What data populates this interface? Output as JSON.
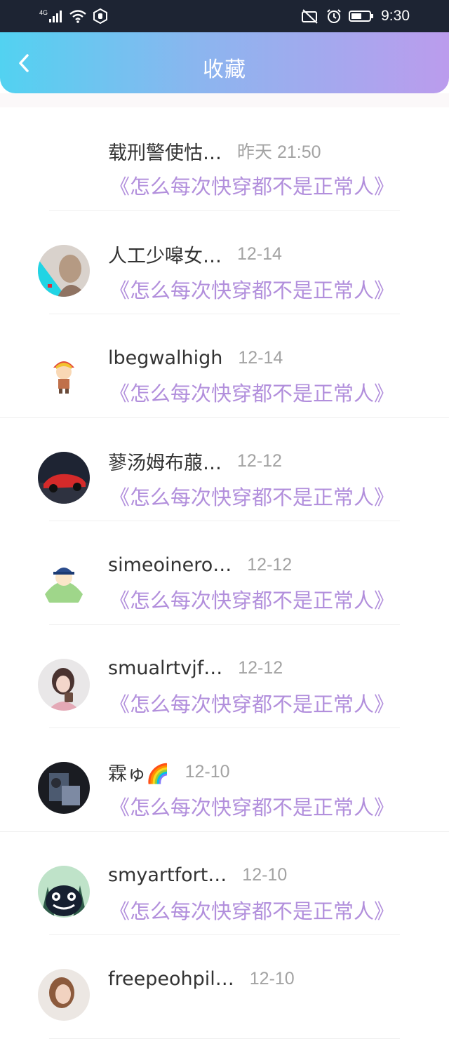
{
  "status_bar": {
    "network": "4G",
    "time": "9:30"
  },
  "header": {
    "title": "收藏"
  },
  "items": [
    {
      "name": "载刑警使怙…",
      "date": "昨天 21:50",
      "book": "《怎么每次快穿都不是正常人》",
      "avatar": "none"
    },
    {
      "name": "人工少嗥女…",
      "date": "12-14",
      "book": "《怎么每次快穿都不是正常人》",
      "avatar": "girl-photo-avatar"
    },
    {
      "name": "lbegwalhigh",
      "date": "12-14",
      "book": "《怎么每次快穿都不是正常人》",
      "avatar": "cartoon-boy-avatar"
    },
    {
      "name": "蓼汤姆布菔…",
      "date": "12-12",
      "book": "《怎么每次快穿都不是正常人》",
      "avatar": "red-car-avatar"
    },
    {
      "name": "simeoinero…",
      "date": "12-12",
      "book": "《怎么每次快穿都不是正常人》",
      "avatar": "cartoon-character-avatar"
    },
    {
      "name": "smualrtvjf…",
      "date": "12-12",
      "book": "《怎么每次快穿都不是正常人》",
      "avatar": "girl-cup-avatar"
    },
    {
      "name": "霖ゅ🌈",
      "date": "12-10",
      "book": "《怎么每次快穿都不是正常人》",
      "avatar": "dark-photo-avatar"
    },
    {
      "name": "smyartfort…",
      "date": "12-10",
      "book": "《怎么每次快穿都不是正常人》",
      "avatar": "totoro-avatar"
    },
    {
      "name": "freepeohpil…",
      "date": "12-10",
      "book": "",
      "avatar": "woman-photo-avatar"
    }
  ],
  "colors": {
    "header_gradient_start": "#52d2f1",
    "header_gradient_end": "#bb9ced",
    "book_title": "#b28fdc",
    "date": "#a3a3a3"
  }
}
